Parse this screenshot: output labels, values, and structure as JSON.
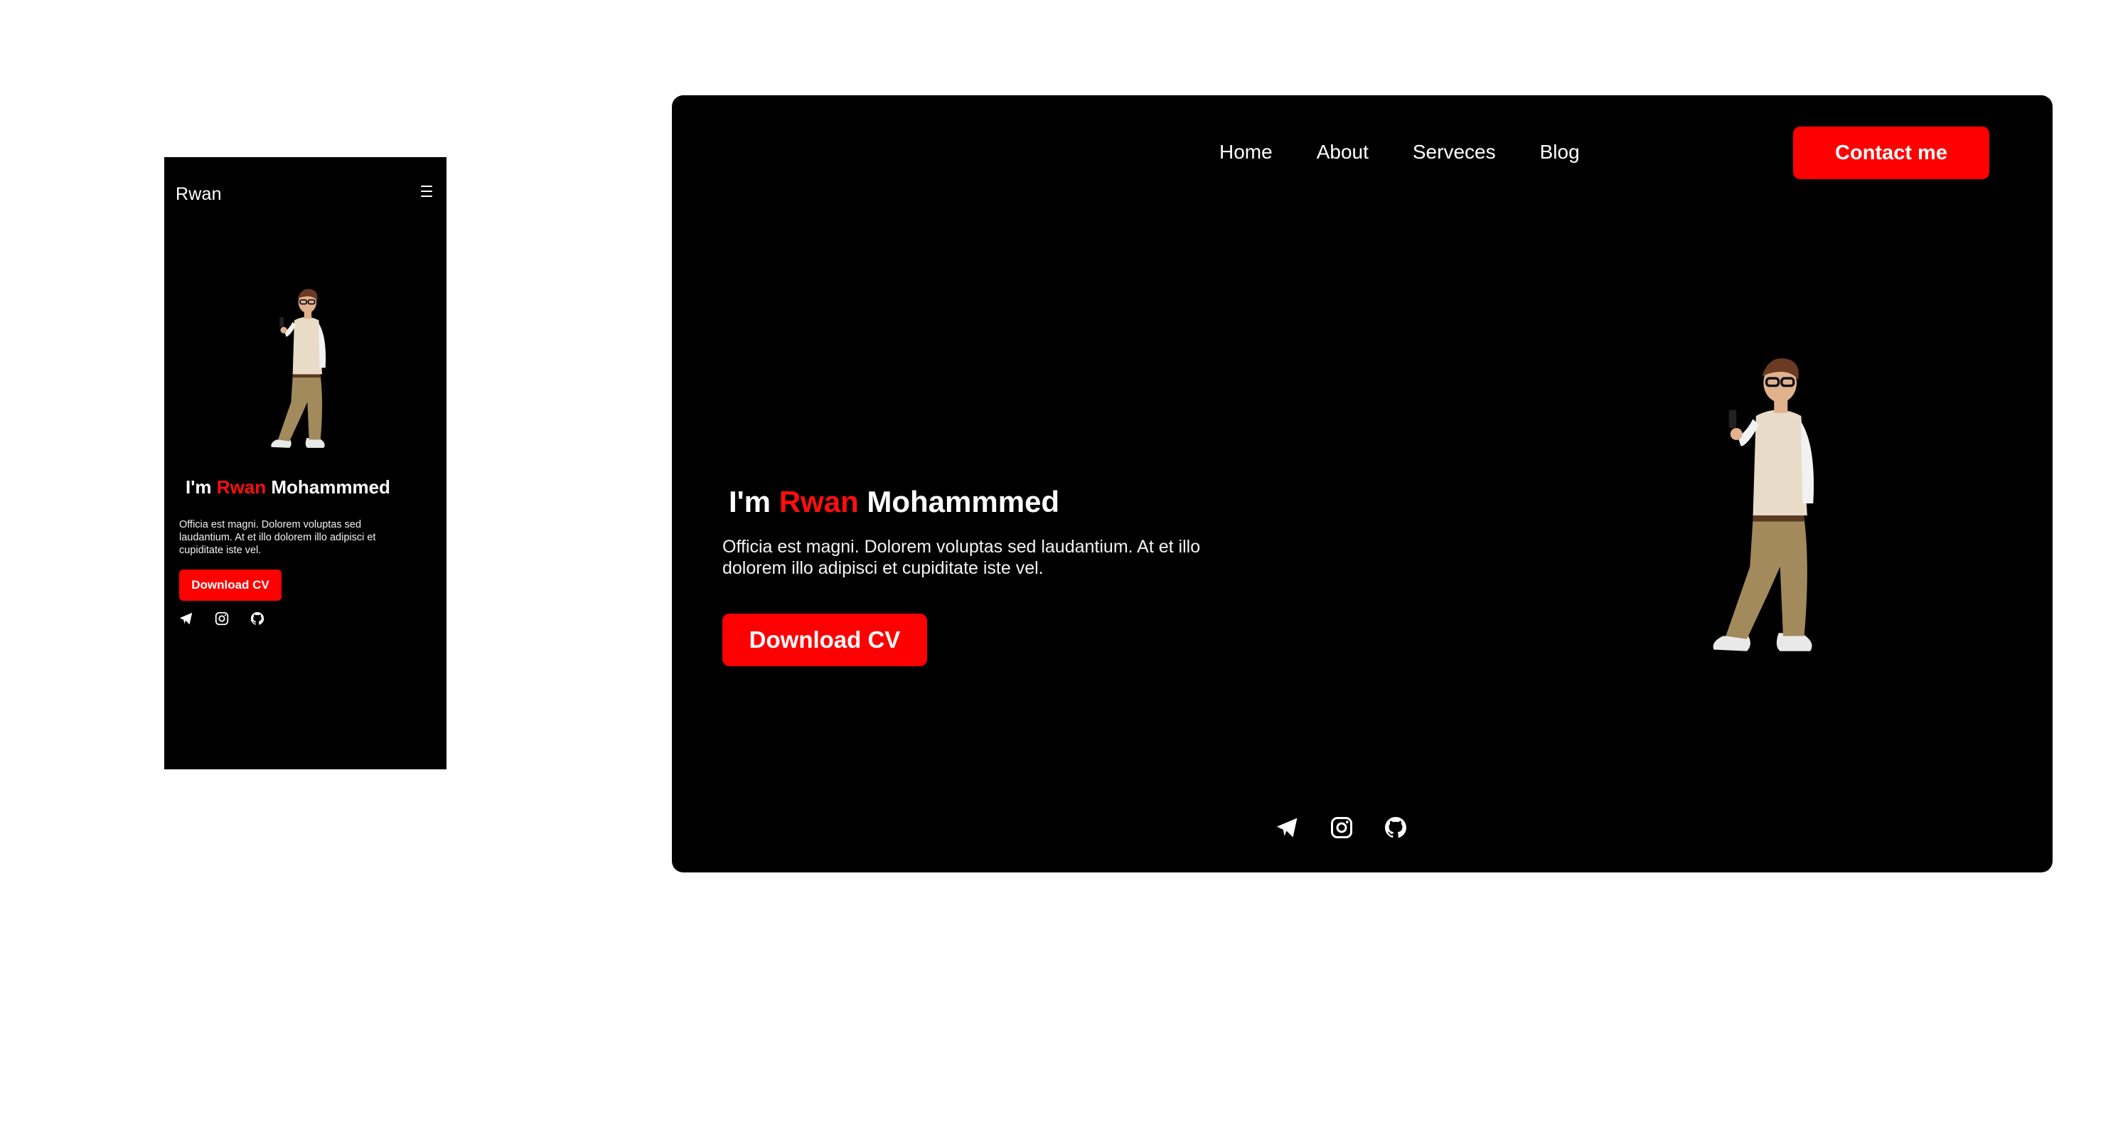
{
  "mobile": {
    "brand": "Rwan",
    "menu_icon": "hamburger-menu-icon",
    "hero": {
      "greeting": "I'm",
      "first_name": "Rwan",
      "last_name": "Mohammmed",
      "description": "Officia est magni. Dolorem voluptas sed laudantium. At et illo dolorem illo adipisci et cupiditate iste vel.",
      "cta_label": "Download CV"
    },
    "socials": [
      "telegram-icon",
      "instagram-icon",
      "github-icon"
    ]
  },
  "desktop": {
    "nav": {
      "items": [
        {
          "label": "Home"
        },
        {
          "label": "About"
        },
        {
          "label": "Serveces"
        },
        {
          "label": "Blog"
        }
      ],
      "contact_label": "Contact me"
    },
    "hero": {
      "greeting": "I'm",
      "first_name": "Rwan",
      "last_name": "Mohammmed",
      "description": "Officia est magni. Dolorem voluptas sed laudantium. At et illo dolorem illo adipisci et cupiditate iste vel.",
      "cta_label": "Download CV"
    },
    "socials": [
      "telegram-icon",
      "instagram-icon",
      "github-icon"
    ]
  },
  "colors": {
    "accent": "#ff0000",
    "background": "#000000",
    "text": "#ffffff",
    "canvas": "#ffffff"
  }
}
